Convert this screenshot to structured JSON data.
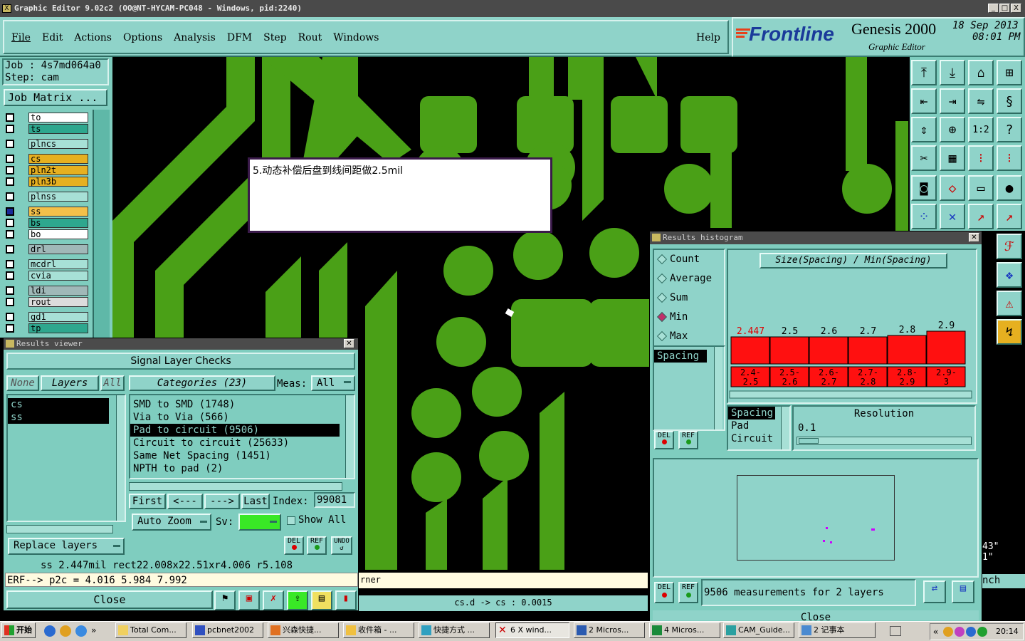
{
  "window": {
    "title": "Graphic Editor 9.02c2  (OO@NT-HYCAM-PC048 - Windows, pid:2240)",
    "buttons": [
      "_",
      "□",
      "X"
    ]
  },
  "menu": {
    "items": [
      "File",
      "Edit",
      "Actions",
      "Options",
      "Analysis",
      "DFM",
      "Step",
      "Rout",
      "Windows"
    ],
    "help": "Help"
  },
  "brand": {
    "logo": "Frontline",
    "product": "Genesis 2000",
    "subtitle": "Graphic Editor",
    "date": "18 Sep 2013",
    "time": "08:01 PM"
  },
  "job": {
    "job_label": "Job : 4s7md064a0",
    "step_label": "Step: cam",
    "matrix_button": "Job Matrix ..."
  },
  "layers": [
    {
      "name": "to",
      "color": "#ffffff"
    },
    {
      "name": "ts",
      "color": "#2ea78e"
    },
    {
      "name": "plncs",
      "color": "#a7e0d6"
    },
    {
      "name": "cs",
      "color": "#e6b020"
    },
    {
      "name": "pln2t",
      "color": "#e6b020"
    },
    {
      "name": "pln3b",
      "color": "#e6b020"
    },
    {
      "name": "plnss",
      "color": "#a7e0d6"
    },
    {
      "name": "ss",
      "color": "#f3c04a"
    },
    {
      "name": "bs",
      "color": "#2ea78e"
    },
    {
      "name": "bo",
      "color": "#ffffff"
    },
    {
      "name": "drl",
      "color": "#a0b8b8"
    },
    {
      "name": "mcdrl",
      "color": "#a7e0d6"
    },
    {
      "name": "cvia",
      "color": "#a7e0d6"
    },
    {
      "name": "ldi",
      "color": "#a0b8b8"
    },
    {
      "name": "rout",
      "color": "#dcdcdc"
    },
    {
      "name": "gd1",
      "color": "#a7e0d6"
    },
    {
      "name": "tp",
      "color": "#2ea78e"
    }
  ],
  "annotation": {
    "text": "5.动态补偿后盘到线间距做2.5mil"
  },
  "results_viewer": {
    "title": "Results viewer",
    "header": "Signal Layer Checks",
    "none_btn": "None",
    "layers_btn": "Layers",
    "all_btn": "All",
    "categories_btn": "Categories (23)",
    "meas_label": "Meas:",
    "meas_value": "All",
    "layer_list": [
      "cs",
      "ss"
    ],
    "categories": [
      "SMD to SMD (1748)",
      "Via to Via (566)",
      "Pad to circuit (9506)",
      "Circuit to circuit (25633)",
      "Same Net Spacing (1451)",
      "NPTH to pad (2)"
    ],
    "first_btn": "First",
    "prev_btn": "<---",
    "next_btn": "--->",
    "last_btn": "Last",
    "index_label": "Index:",
    "index_value": "99081",
    "auto_zoom": "Auto Zoom",
    "sv_label": "Sv:",
    "show_all": "Show All",
    "replace_layers": "Replace layers",
    "del": "DEL",
    "ref": "REF",
    "undo": "UNDO",
    "status_line": "ss 2.447mil  rect22.008x22.51xr4.006  r5.108",
    "erf_line": "ERF--> p2c = 4.016 5.984 7.992",
    "close_btn": "Close"
  },
  "status_bar": {
    "corner_text": "rner",
    "coords": "cs.d -> cs : 0.0015"
  },
  "histogram": {
    "title": "Results histogram",
    "modes": [
      "Count",
      "Average",
      "Sum",
      "Min",
      "Max"
    ],
    "selected_mode": "Min",
    "chart_title": "Size(Spacing) / Min(Spacing)",
    "measure_list": [
      "Spacing"
    ],
    "del": "DEL",
    "ref": "REF",
    "resolution_label": "Resolution",
    "resolution_value": "0.1",
    "type_list": [
      "Spacing",
      "Pad",
      "Circuit"
    ],
    "summary": "9506 measurements for 2 layers",
    "close_btn": "Close"
  },
  "chart_data": {
    "type": "bar",
    "title": "Size(Spacing) / Min(Spacing)",
    "categories": [
      "2.4-2.5",
      "2.5-2.6",
      "2.6-2.7",
      "2.7-2.8",
      "2.8-2.9",
      "2.9-3"
    ],
    "values": [
      2.447,
      2.5,
      2.6,
      2.7,
      2.8,
      2.9
    ],
    "value_labels": [
      "2.447",
      "2.5",
      "2.6",
      "2.7",
      "2.8",
      "2.9"
    ],
    "bar_color": "#ff1010",
    "first_label_color": "#e00000"
  },
  "right_clipped": {
    "text1": "43\"",
    "text2": "1\"",
    "text3": "nch"
  },
  "taskbar": {
    "start": "开始",
    "items": [
      "Total Com...",
      "pcbnet2002",
      "兴森快捷...",
      "收件箱 - ...",
      "快捷方式 ...",
      "6 X wind...",
      "2 Micros...",
      "4 Micros...",
      "CAM_Guide...",
      "2 记事本"
    ],
    "time": "20:14"
  }
}
